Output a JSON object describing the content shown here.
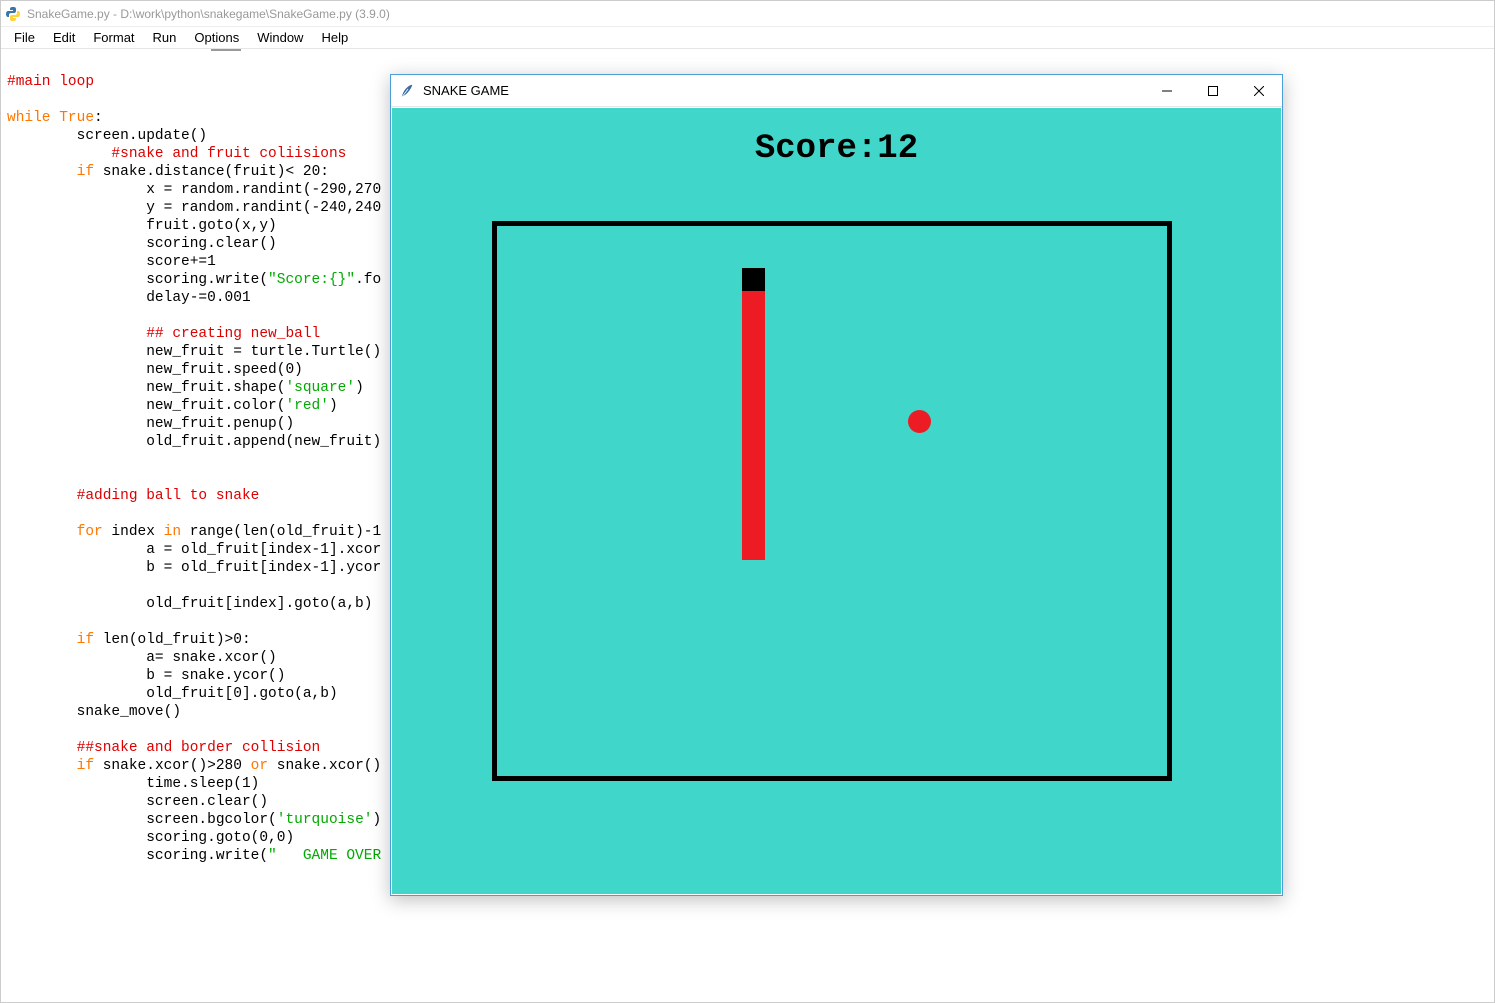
{
  "idle": {
    "title": "SnakeGame.py - D:\\work\\python\\snakegame\\SnakeGame.py (3.9.0)",
    "menu": [
      "File",
      "Edit",
      "Format",
      "Run",
      "Options",
      "Window",
      "Help"
    ]
  },
  "code": {
    "l1": "#main loop",
    "l2": "",
    "l3a": "while",
    "l3b": " ",
    "l3c": "True",
    "l3d": ":",
    "l4": "        screen.update()",
    "l5": "            #snake and fruit coliisions",
    "l6a": "        ",
    "l6b": "if",
    "l6c": " snake.distance(fruit)< 20:",
    "l7": "                x = random.randint(-290,270",
    "l8": "                y = random.randint(-240,240",
    "l9": "                fruit.goto(x,y)",
    "l10": "                scoring.clear()",
    "l11": "                score+=1",
    "l12a": "                scoring.write(",
    "l12b": "\"Score:{}\"",
    "l12c": ".fo",
    "l13": "                delay-=0.001",
    "l14": "",
    "l15": "                ## creating new_ball",
    "l16": "                new_fruit = turtle.Turtle()",
    "l17": "                new_fruit.speed(0)",
    "l18a": "                new_fruit.shape(",
    "l18b": "'square'",
    "l18c": ")",
    "l19a": "                new_fruit.color(",
    "l19b": "'red'",
    "l19c": ")",
    "l20": "                new_fruit.penup()",
    "l21": "                old_fruit.append(new_fruit)",
    "l22": "",
    "l23": "",
    "l24": "        #adding ball to snake",
    "l25": "",
    "l26a": "        ",
    "l26b": "for",
    "l26c": " index ",
    "l26d": "in",
    "l26e": " range(len(old_fruit)-1",
    "l27": "                a = old_fruit[index-1].xcor",
    "l28": "                b = old_fruit[index-1].ycor",
    "l29": "",
    "l30": "                old_fruit[index].goto(a,b)",
    "l31": "",
    "l32a": "        ",
    "l32b": "if",
    "l32c": " len(old_fruit)>0:",
    "l33": "                a= snake.xcor()",
    "l34": "                b = snake.ycor()",
    "l35": "                old_fruit[0].goto(a,b)",
    "l36": "        snake_move()",
    "l37": "",
    "l38": "        ##snake and border collision",
    "l39a": "        ",
    "l39b": "if",
    "l39c": " snake.xcor()>280 ",
    "l39d": "or",
    "l39e": " snake.xcor()",
    "l40": "                time.sleep(1)",
    "l41": "                screen.clear()",
    "l42a": "                screen.bgcolor(",
    "l42b": "'turquoise'",
    "l42c": ")",
    "l43": "                scoring.goto(0,0)",
    "l44a": "                scoring.write(",
    "l44b": "\"   GAME OVER"
  },
  "game": {
    "title": "SNAKE GAME",
    "score_label": "Score:",
    "score_value": "12"
  }
}
